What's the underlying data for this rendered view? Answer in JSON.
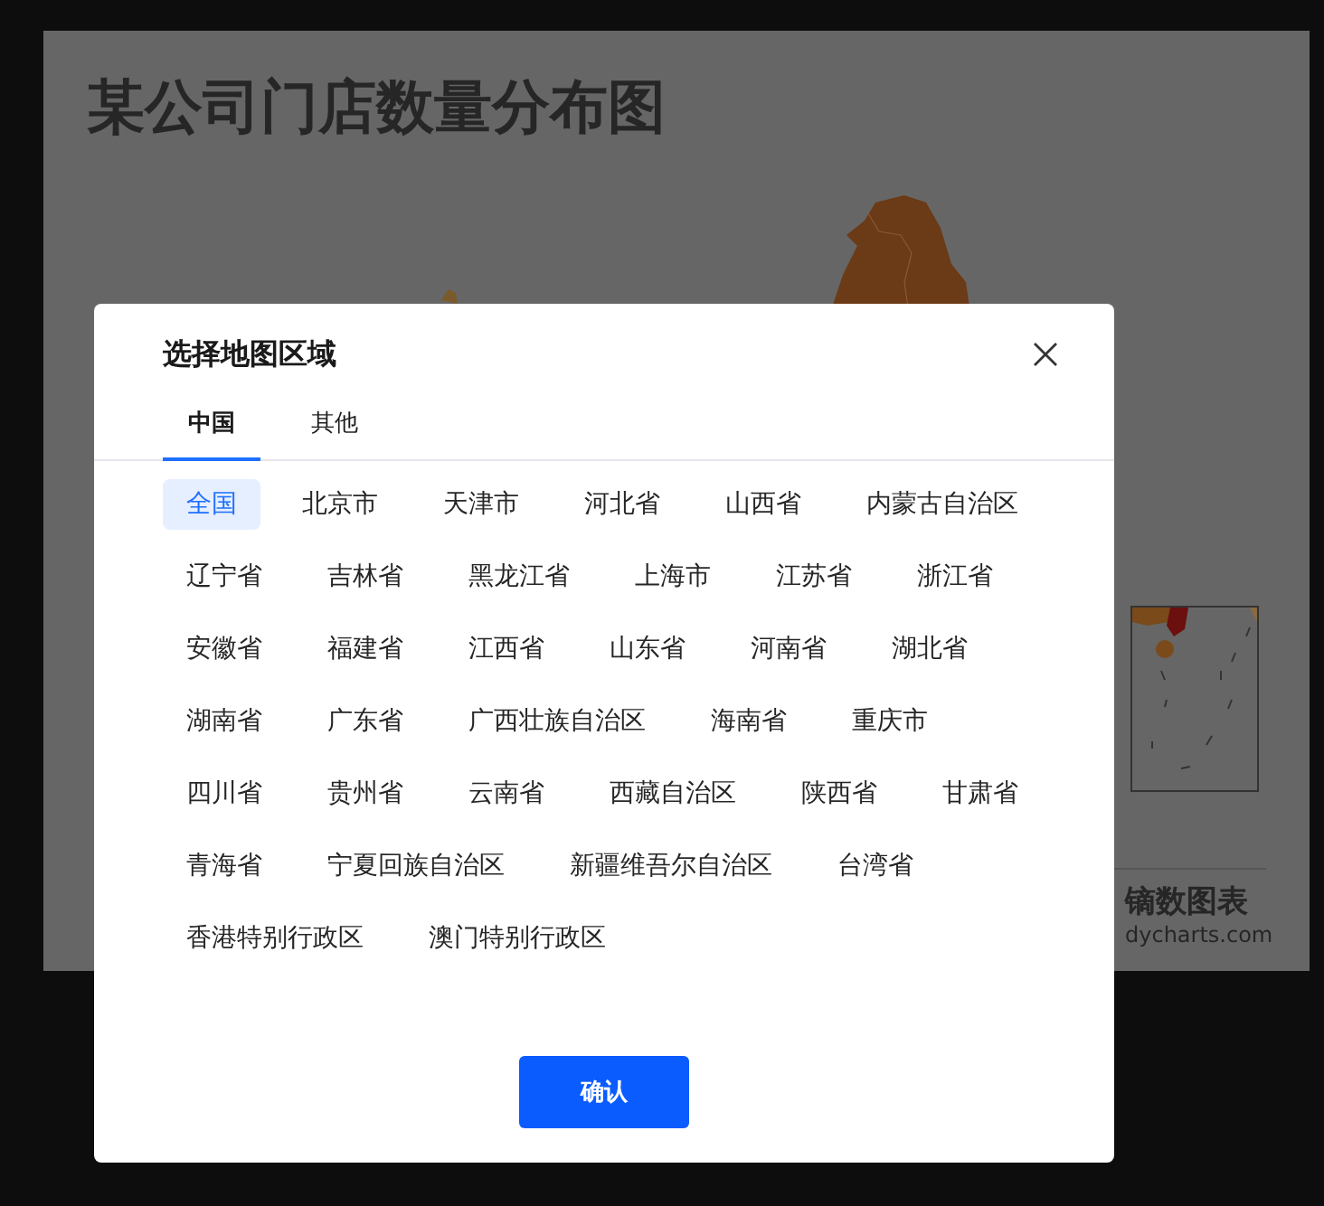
{
  "page": {
    "title": "某公司门店数量分布图",
    "logo": {
      "name": "镝数图表",
      "url": "dycharts.com"
    }
  },
  "dialog": {
    "title": "选择地图区域",
    "tabs": [
      {
        "label": "中国",
        "selected": true
      },
      {
        "label": "其他",
        "selected": false
      }
    ],
    "regions": [
      {
        "label": "全国",
        "selected": true
      },
      {
        "label": "北京市",
        "selected": false
      },
      {
        "label": "天津市",
        "selected": false
      },
      {
        "label": "河北省",
        "selected": false
      },
      {
        "label": "山西省",
        "selected": false
      },
      {
        "label": "内蒙古自治区",
        "selected": false
      },
      {
        "label": "辽宁省",
        "selected": false
      },
      {
        "label": "吉林省",
        "selected": false
      },
      {
        "label": "黑龙江省",
        "selected": false
      },
      {
        "label": "上海市",
        "selected": false
      },
      {
        "label": "江苏省",
        "selected": false
      },
      {
        "label": "浙江省",
        "selected": false
      },
      {
        "label": "安徽省",
        "selected": false
      },
      {
        "label": "福建省",
        "selected": false
      },
      {
        "label": "江西省",
        "selected": false
      },
      {
        "label": "山东省",
        "selected": false
      },
      {
        "label": "河南省",
        "selected": false
      },
      {
        "label": "湖北省",
        "selected": false
      },
      {
        "label": "湖南省",
        "selected": false
      },
      {
        "label": "广东省",
        "selected": false
      },
      {
        "label": "广西壮族自治区",
        "selected": false
      },
      {
        "label": "海南省",
        "selected": false
      },
      {
        "label": "重庆市",
        "selected": false
      },
      {
        "label": "四川省",
        "selected": false
      },
      {
        "label": "贵州省",
        "selected": false
      },
      {
        "label": "云南省",
        "selected": false
      },
      {
        "label": "西藏自治区",
        "selected": false
      },
      {
        "label": "陕西省",
        "selected": false
      },
      {
        "label": "甘肃省",
        "selected": false
      },
      {
        "label": "青海省",
        "selected": false
      },
      {
        "label": "宁夏回族自治区",
        "selected": false
      },
      {
        "label": "新疆维吾尔自治区",
        "selected": false
      },
      {
        "label": "台湾省",
        "selected": false
      },
      {
        "label": "香港特别行政区",
        "selected": false
      },
      {
        "label": "澳门特别行政区",
        "selected": false
      }
    ],
    "confirm_button": "确认"
  }
}
